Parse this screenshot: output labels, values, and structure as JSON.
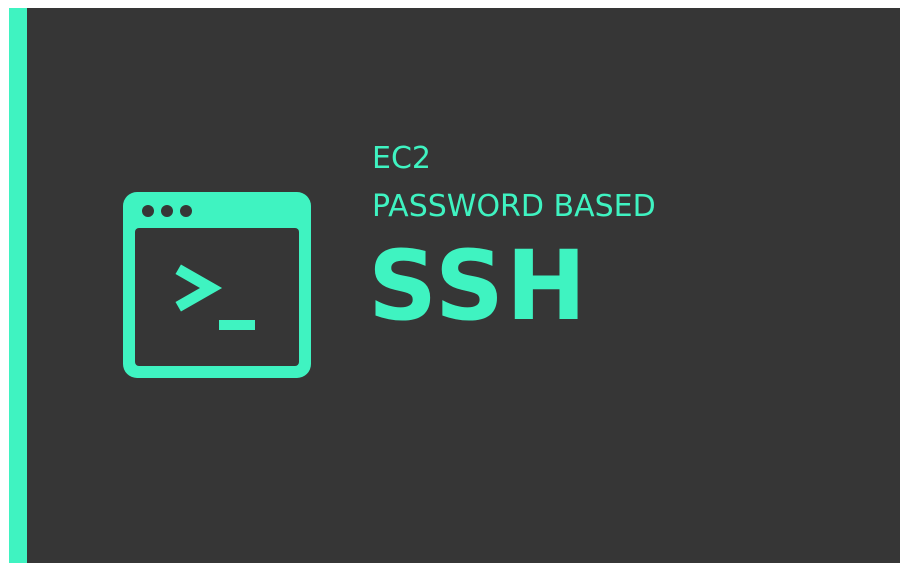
{
  "colors": {
    "accent": "#3ff3c1",
    "panel_background": "#363636",
    "page_background": "#ffffff"
  },
  "icon": {
    "name": "terminal-window-icon",
    "prompt_glyph": ">_"
  },
  "headline": {
    "line1": "EC2",
    "line2": "PASSWORD BASED",
    "main": "SSH"
  }
}
